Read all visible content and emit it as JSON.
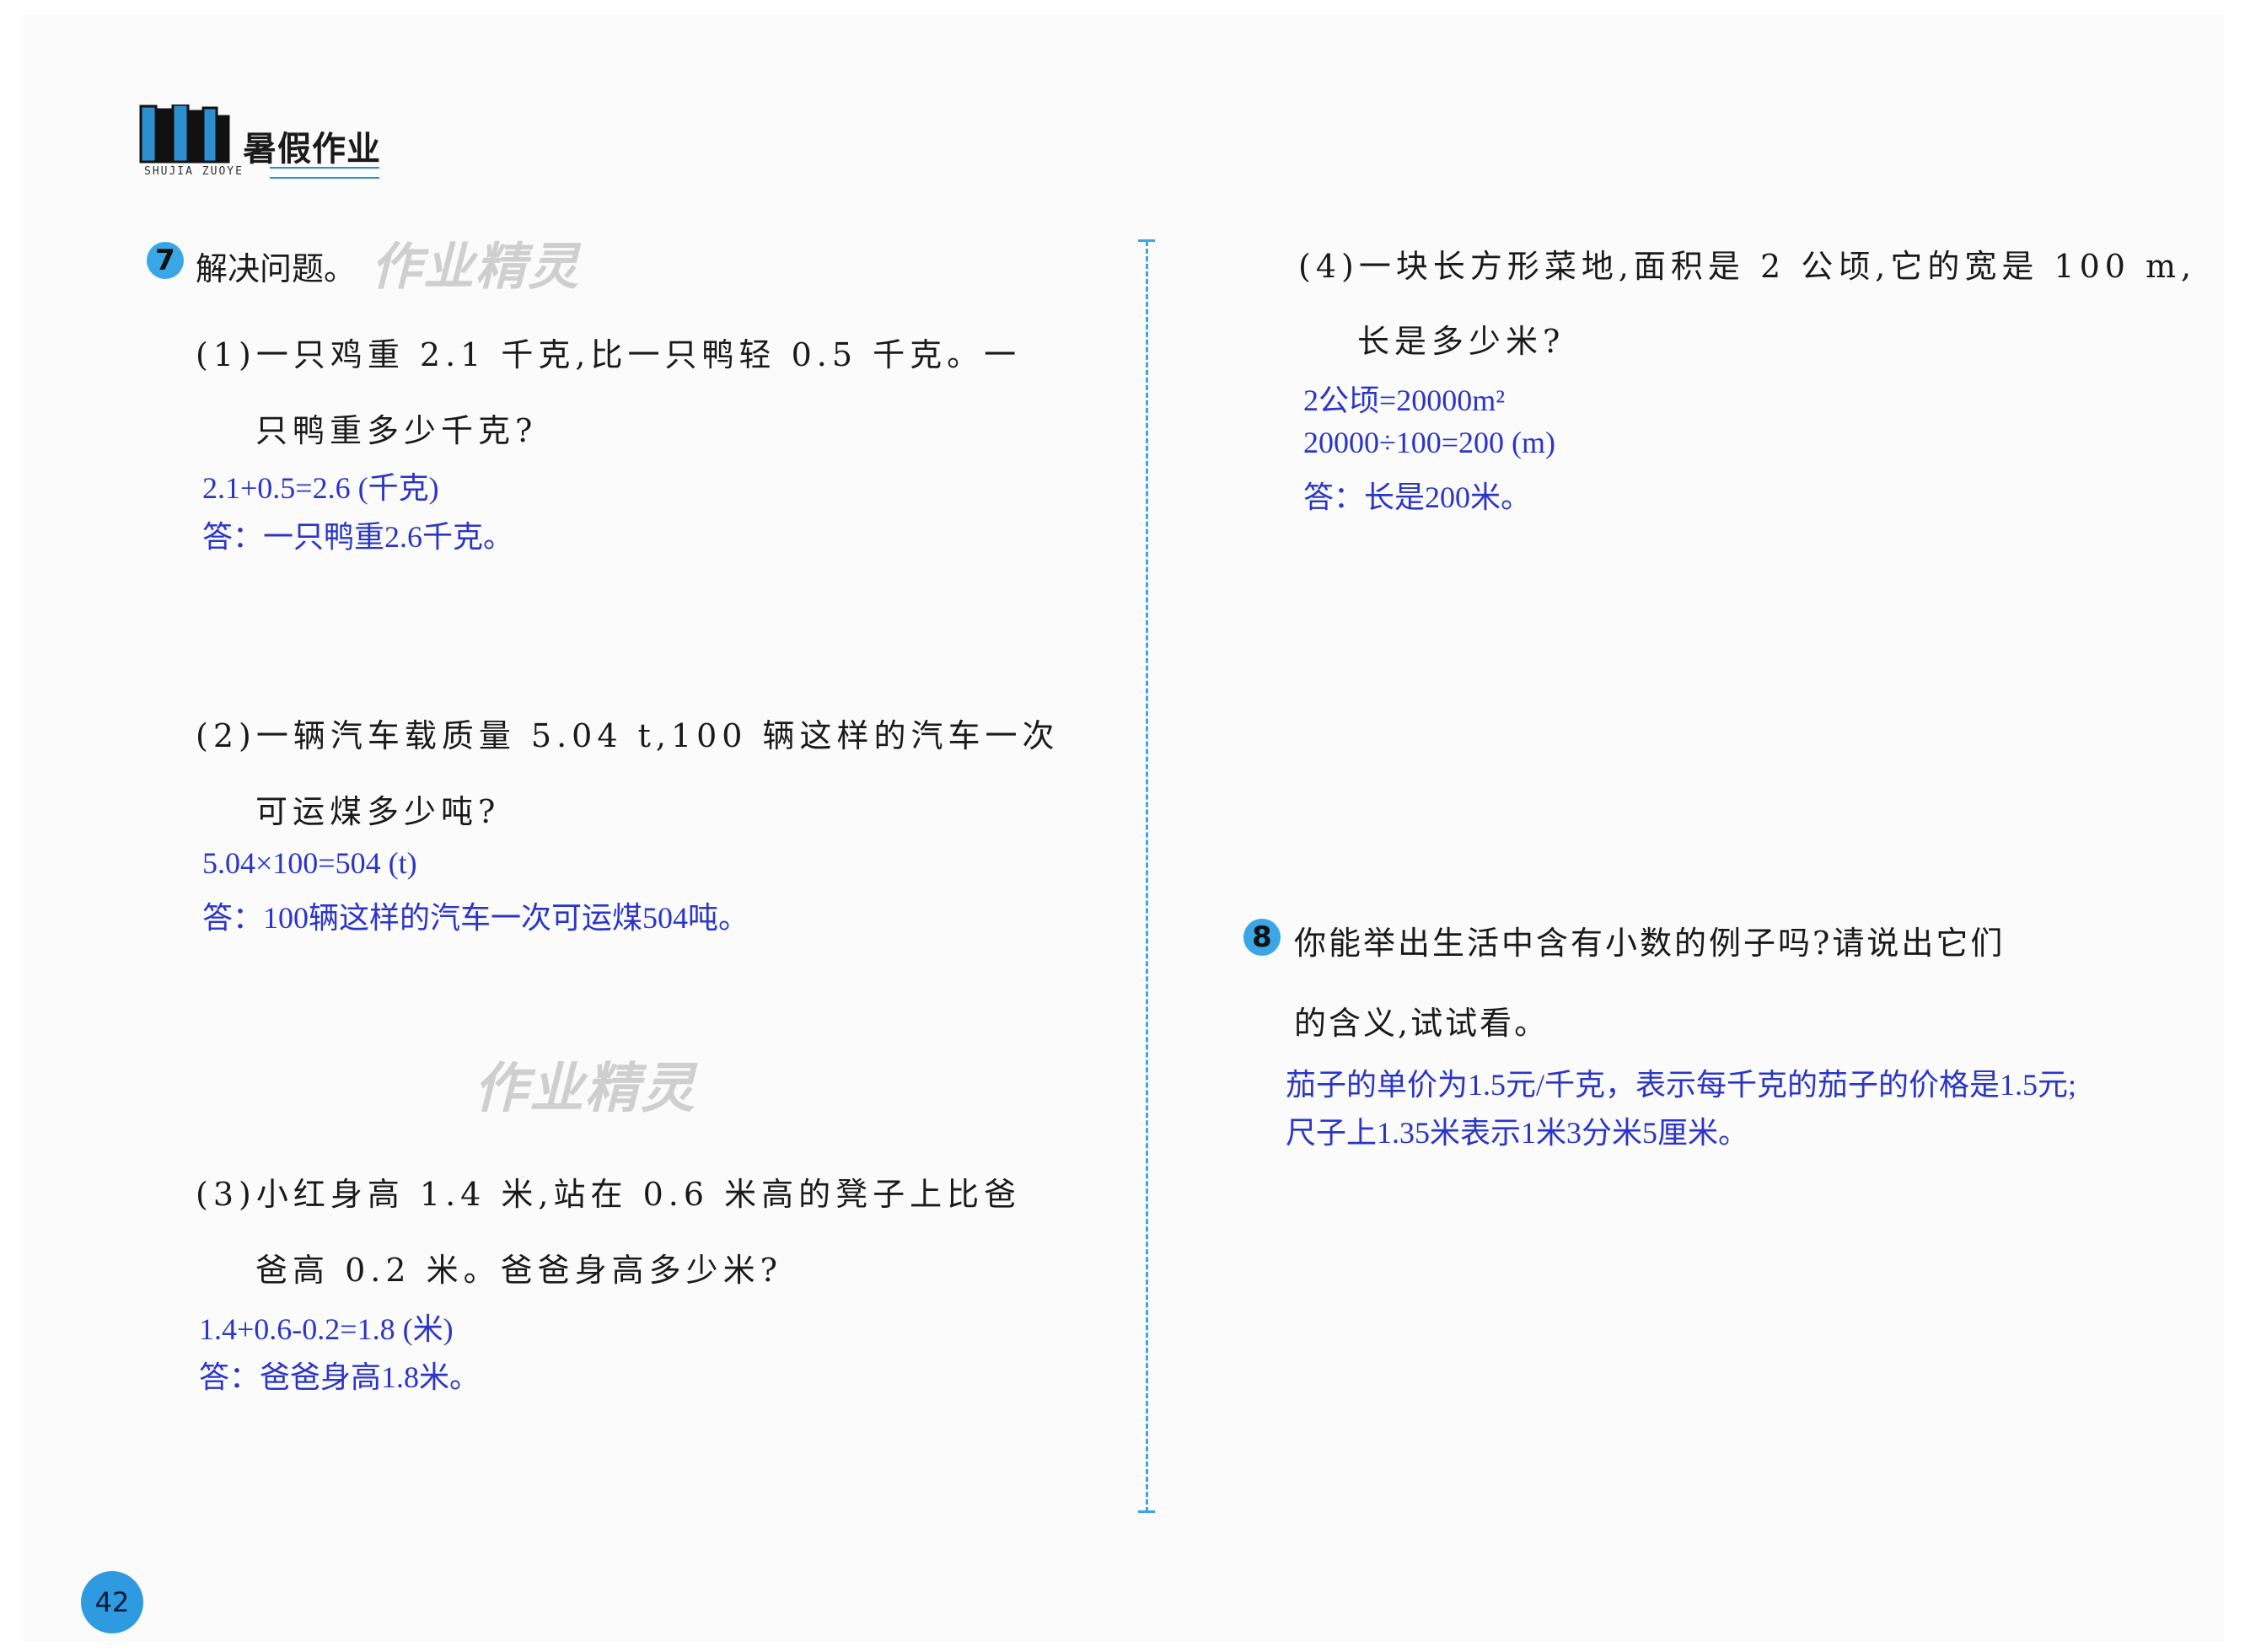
{
  "header": {
    "title": "暑假作业",
    "subtitle": "SHUJIA ZUOYE"
  },
  "watermark": "作业精灵",
  "page_number": "42",
  "q7": {
    "number": "7",
    "title": "解决问题。",
    "p1": {
      "line1": "(1)一只鸡重 2.1 千克,比一只鸭轻 0.5 千克。一",
      "line2": "只鸭重多少千克?",
      "ans1": "2.1+0.5=2.6 (千克)",
      "ans2": "答：一只鸭重2.6千克。"
    },
    "p2": {
      "line1": "(2)一辆汽车载质量 5.04 t,100 辆这样的汽车一次",
      "line2": "可运煤多少吨?",
      "ans1": "5.04×100=504 (t)",
      "ans2": "答：100辆这样的汽车一次可运煤504吨。"
    },
    "p3": {
      "line1": "(3)小红身高 1.4 米,站在 0.6 米高的凳子上比爸",
      "line2": "爸高 0.2 米。爸爸身高多少米?",
      "ans1": "1.4+0.6-0.2=1.8 (米)",
      "ans2": "答：爸爸身高1.8米。"
    },
    "p4": {
      "line1": "(4)一块长方形菜地,面积是 2 公顷,它的宽是 100 m,",
      "line2": "长是多少米?",
      "ans1": "2公顷=20000m²",
      "ans2": "20000÷100=200 (m)",
      "ans3": "答：长是200米。"
    }
  },
  "q8": {
    "number": "8",
    "line1": "你能举出生活中含有小数的例子吗?请说出它们",
    "line2": "的含义,试试看。",
    "ans1": "茄子的单价为1.5元/千克，表示每千克的茄子的价格是1.5元;",
    "ans2": "尺子上1.35米表示1米3分米5厘米。"
  }
}
